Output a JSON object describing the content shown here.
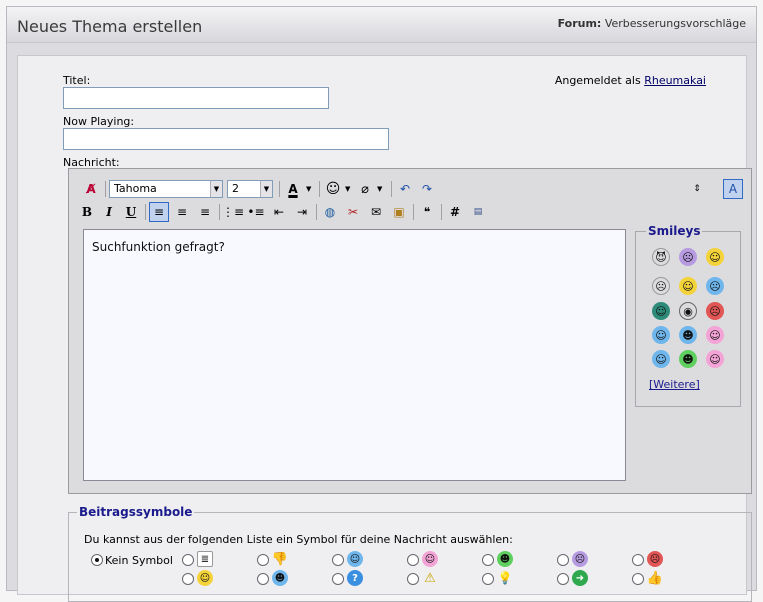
{
  "header": {
    "title": "Neues Thema erstellen",
    "forum_label": "Forum:",
    "forum_name": "Verbesserungsvorschläge"
  },
  "form": {
    "title_label": "Titel:",
    "title_value": "",
    "now_playing_label": "Now Playing:",
    "now_playing_value": "",
    "message_label": "Nachricht:",
    "logged_in_prefix": "Angemeldet als",
    "username": "Rheumakai"
  },
  "editor": {
    "font_value": "Tahoma",
    "size_value": "2",
    "bold": "B",
    "italic": "I",
    "underline": "U",
    "hash": "#",
    "message_text": "Suchfunktion gefragt?"
  },
  "smileys": {
    "legend": "Smileys",
    "more": "[Weitere]",
    "colors": {
      "yellow": "#f4d23a",
      "blue": "#6fb6ec",
      "purple": "#b79be0",
      "red": "#e25555",
      "green": "#5fcf5f",
      "pink": "#f3a3d6"
    }
  },
  "post_icons": {
    "legend": "Beitragssymbole",
    "help": "Du kannst aus der folgenden Liste ein Symbol für deine Nachricht auswählen:",
    "none_label": "Kein Symbol"
  }
}
